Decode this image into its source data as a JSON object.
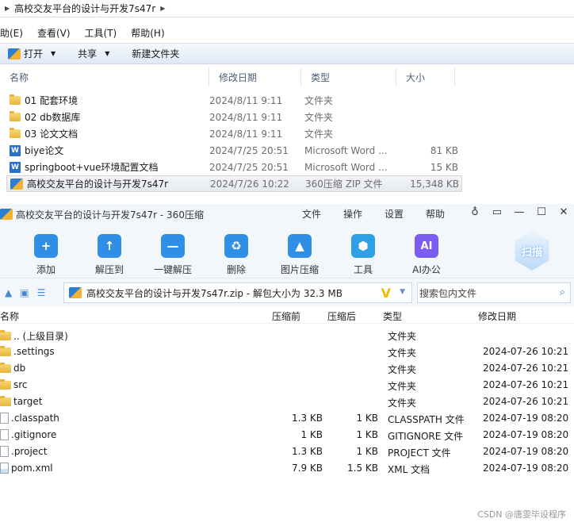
{
  "explorer": {
    "breadcrumb": "高校交友平台的设计与开发7s47r",
    "menu": [
      "助(E)",
      "查看(V)",
      "工具(T)",
      "帮助(H)"
    ],
    "toolbar": {
      "open": "打开",
      "share": "共享",
      "new_folder": "新建文件夹"
    },
    "columns": {
      "name": "名称",
      "date": "修改日期",
      "type": "类型",
      "size": "大小"
    },
    "rows": [
      {
        "name": "01 配套环境",
        "date": "2024/8/11 9:11",
        "type": "文件夹",
        "size": "",
        "icon": "folder-icon"
      },
      {
        "name": "02 db数据库",
        "date": "2024/8/11 9:11",
        "type": "文件夹",
        "size": "",
        "icon": "folder-icon"
      },
      {
        "name": "03 论文文档",
        "date": "2024/8/11 9:11",
        "type": "文件夹",
        "size": "",
        "icon": "folder-icon"
      },
      {
        "name": "biye论文",
        "date": "2024/7/25 20:51",
        "type": "Microsoft Word ...",
        "size": "81 KB",
        "icon": "word-icon"
      },
      {
        "name": "springboot+vue环境配置文档",
        "date": "2024/7/25 20:51",
        "type": "Microsoft Word ...",
        "size": "15 KB",
        "icon": "word-icon"
      },
      {
        "name": "高校交友平台的设计与开发7s47r",
        "date": "2024/7/26 10:22",
        "type": "360压缩 ZIP 文件",
        "size": "15,348 KB",
        "icon": "zip-icon"
      }
    ]
  },
  "zip": {
    "title": "高校交友平台的设计与开发7s47r - 360压缩",
    "menu": [
      "文件",
      "操作",
      "设置",
      "帮助"
    ],
    "tools": [
      {
        "label": "添加",
        "icon": "add-icon",
        "glyph": "+",
        "color": "#2f8fe6"
      },
      {
        "label": "解压到",
        "icon": "extract-icon",
        "glyph": "↑",
        "color": "#2f8fe6"
      },
      {
        "label": "一键解压",
        "icon": "one-click-extract-icon",
        "glyph": "—",
        "color": "#2f8fe6"
      },
      {
        "label": "删除",
        "icon": "recycle-icon",
        "glyph": "♻",
        "color": "#2f8fe6"
      },
      {
        "label": "图片压缩",
        "icon": "image-compress-icon",
        "glyph": "▲",
        "color": "#2f8fe6"
      },
      {
        "label": "工具",
        "icon": "tools-icon",
        "glyph": "⬢",
        "color": "#2f9fe6"
      },
      {
        "label": "AI办公",
        "icon": "ai-icon",
        "glyph": "AI",
        "color": "#7a5cf0"
      }
    ],
    "scan_label": "扫描",
    "path": "高校交友平台的设计与开发7s47r.zip - 解包大小为 32.3 MB",
    "search_placeholder": "搜索包内文件",
    "columns": {
      "name": "名称",
      "size": "压缩前",
      "csize": "压缩后",
      "type": "类型",
      "date": "修改日期"
    },
    "rows": [
      {
        "name": ".. (上级目录)",
        "size": "",
        "csize": "",
        "type": "文件夹",
        "date": "",
        "icon": "folder-icon"
      },
      {
        "name": ".settings",
        "size": "",
        "csize": "",
        "type": "文件夹",
        "date": "2024-07-26 10:21",
        "icon": "folder-icon"
      },
      {
        "name": "db",
        "size": "",
        "csize": "",
        "type": "文件夹",
        "date": "2024-07-26 10:21",
        "icon": "folder-icon"
      },
      {
        "name": "src",
        "size": "",
        "csize": "",
        "type": "文件夹",
        "date": "2024-07-26 10:21",
        "icon": "folder-icon"
      },
      {
        "name": "target",
        "size": "",
        "csize": "",
        "type": "文件夹",
        "date": "2024-07-26 10:21",
        "icon": "folder-icon"
      },
      {
        "name": ".classpath",
        "size": "1.3 KB",
        "csize": "1 KB",
        "type": "CLASSPATH 文件",
        "date": "2024-07-19 08:20",
        "icon": "file-icon"
      },
      {
        "name": ".gitignore",
        "size": "1 KB",
        "csize": "1 KB",
        "type": "GITIGNORE 文件",
        "date": "2024-07-19 08:20",
        "icon": "file-icon"
      },
      {
        "name": ".project",
        "size": "1.3 KB",
        "csize": "1 KB",
        "type": "PROJECT 文件",
        "date": "2024-07-19 08:20",
        "icon": "file-icon"
      },
      {
        "name": "pom.xml",
        "size": "7.9 KB",
        "csize": "1.5 KB",
        "type": "XML 文档",
        "date": "2024-07-19 08:20",
        "icon": "xml-icon"
      }
    ]
  },
  "watermark": "CSDN @唐雯毕设程序"
}
